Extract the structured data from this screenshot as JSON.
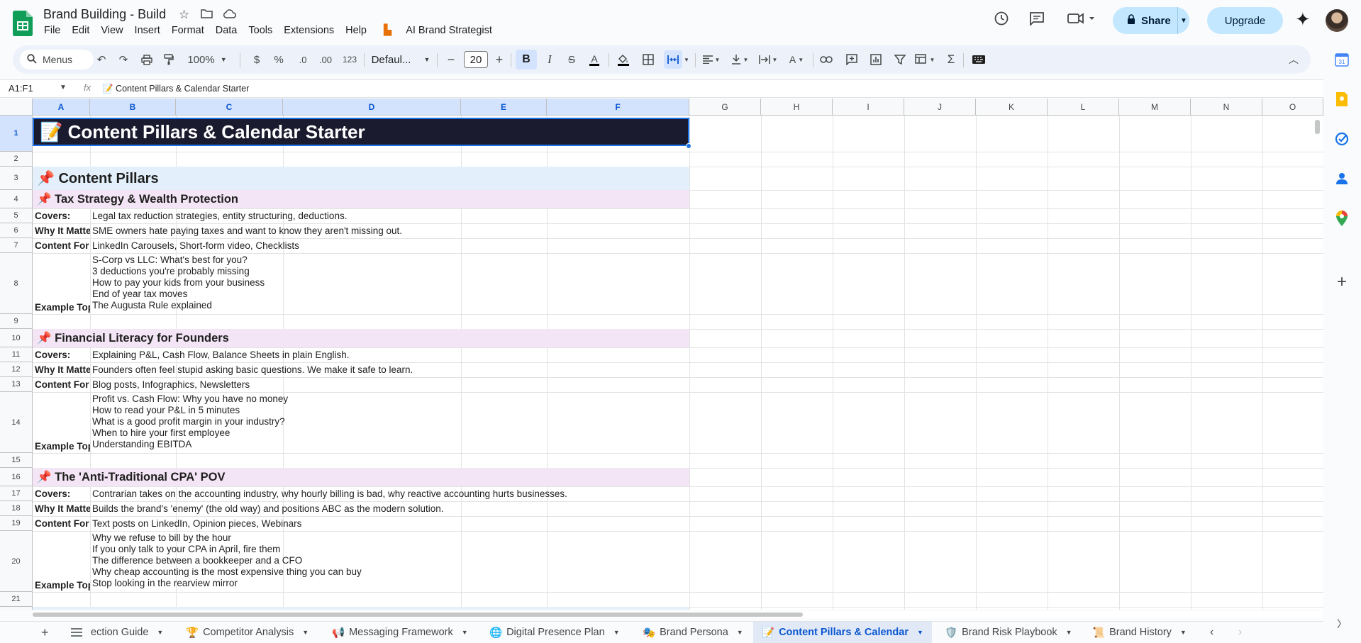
{
  "app": {
    "doc_title": "Brand Building - Build",
    "menu": [
      "File",
      "Edit",
      "View",
      "Insert",
      "Format",
      "Data",
      "Tools",
      "Extensions",
      "Help"
    ],
    "addon_menu": "AI Brand Strategist",
    "share_label": "Share",
    "upgrade_label": "Upgrade"
  },
  "toolbar": {
    "search_label": "Menus",
    "zoom": "100%",
    "currency": "$",
    "percent": "%",
    "dec_dec": ".0",
    "inc_dec": ".00",
    "format_123": "123",
    "font": "Defaul...",
    "font_size": "20"
  },
  "formula_bar": {
    "name_box": "A1:F1",
    "fx": "fx",
    "content": "📝 Content Pillars & Calendar Starter"
  },
  "columns": [
    "A",
    "B",
    "C",
    "D",
    "E",
    "F",
    "G",
    "H",
    "I",
    "J",
    "K",
    "L",
    "M",
    "N",
    "O"
  ],
  "rows": [
    "1",
    "2",
    "3",
    "4",
    "5",
    "6",
    "7",
    "8",
    "9",
    "10",
    "11",
    "12",
    "13",
    "14",
    "15",
    "16",
    "17",
    "18",
    "19",
    "20",
    "21"
  ],
  "sheet": {
    "title": "📝 Content Pillars & Calendar Starter",
    "section_heading": "📌 Content Pillars",
    "pillars": [
      {
        "heading": "📌 Tax Strategy & Wealth Protection",
        "covers_label": "Covers:",
        "covers": "Legal tax reduction strategies, entity structuring, deductions.",
        "why_label": "Why It Matte",
        "why": "SME owners hate paying taxes and want to know they aren't missing out.",
        "format_label": "Content For",
        "format": "LinkedIn Carousels, Short-form video, Checklists",
        "topics_label": "Example Top",
        "topics": "S-Corp vs LLC: What's best for you?\n3 deductions you're probably missing\nHow to pay your kids from your business\nEnd of year tax moves\nThe Augusta Rule explained"
      },
      {
        "heading": "📌 Financial Literacy for Founders",
        "covers_label": "Covers:",
        "covers": "Explaining P&L, Cash Flow, Balance Sheets in plain English.",
        "why_label": "Why It Matte",
        "why": "Founders often feel stupid asking basic questions. We make it safe to learn.",
        "format_label": "Content For",
        "format": "Blog posts, Infographics, Newsletters",
        "topics_label": "Example Top",
        "topics": "Profit vs. Cash Flow: Why you have no money\nHow to read your P&L in 5 minutes\nWhat is a good profit margin in your industry?\nWhen to hire your first employee\nUnderstanding EBITDA"
      },
      {
        "heading": "📌 The 'Anti-Traditional CPA' POV",
        "covers_label": "Covers:",
        "covers": "Contrarian takes on the accounting industry, why hourly billing is bad, why reactive accounting hurts businesses.",
        "why_label": "Why It Matte",
        "why": "Builds the brand's 'enemy' (the old way) and positions ABC as the modern solution.",
        "format_label": "Content For",
        "format": "Text posts on LinkedIn, Opinion pieces, Webinars",
        "topics_label": "Example Top",
        "topics": "Why we refuse to bill by the hour\nIf you only talk to your CPA in April, fire them\nThe difference between a bookkeeper and a CFO\nWhy cheap accounting is the most expensive thing you can buy\nStop looking in the rearview mirror"
      }
    ]
  },
  "tabs": [
    {
      "label": "ection Guide",
      "icon": ""
    },
    {
      "label": "Competitor Analysis",
      "icon": "🏆"
    },
    {
      "label": "Messaging Framework",
      "icon": "📢"
    },
    {
      "label": "Digital Presence Plan",
      "icon": "🌐"
    },
    {
      "label": "Brand Persona",
      "icon": "🎭"
    },
    {
      "label": "Content Pillars & Calendar",
      "icon": "📝"
    },
    {
      "label": "Brand Risk Playbook",
      "icon": "🛡️"
    },
    {
      "label": "Brand History",
      "icon": "📜"
    }
  ],
  "colors": {
    "accent": "#1a73e8",
    "title_bg": "#1b1b2f",
    "section_bg": "#e3f0fb",
    "pillar_bg": "#f3e5f5"
  }
}
